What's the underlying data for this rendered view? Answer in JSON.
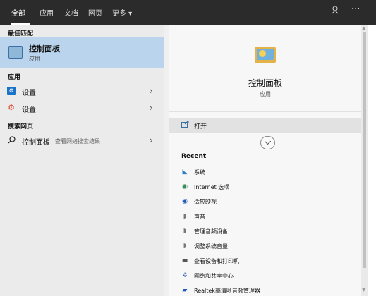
{
  "topbar": {
    "tabs": [
      {
        "label": "全部"
      },
      {
        "label": "应用"
      },
      {
        "label": "文档"
      },
      {
        "label": "网页"
      },
      {
        "label": "更多 ▾"
      }
    ],
    "feedback_icon": "feedback-icon",
    "more_icon": "ellipsis-icon"
  },
  "left": {
    "best_match_header": "最佳匹配",
    "best_match": {
      "title": "控制面板",
      "subtitle": "应用",
      "icon": "control-panel-icon"
    },
    "apps_header": "应用",
    "apps": [
      {
        "label": "设置",
        "icon": "gear-icon"
      },
      {
        "label": "设置",
        "icon": "gear-orange-icon"
      }
    ],
    "web_header": "搜索网页",
    "web_result": {
      "label": "控制面板",
      "hint": "查看网络搜索结果",
      "icon": "search-icon"
    }
  },
  "right": {
    "title": "控制面板",
    "subtitle": "应用",
    "open_label": "打开",
    "recent_header": "Recent",
    "recent": [
      {
        "label": "系统"
      },
      {
        "label": "Internet 选项"
      },
      {
        "label": "适应映视"
      },
      {
        "label": "声音"
      },
      {
        "label": "管理音频设备"
      },
      {
        "label": "调整系统音量"
      },
      {
        "label": "查看设备和打印机"
      },
      {
        "label": "网络和共享中心"
      },
      {
        "label": "Realtek高清晰音频管理器"
      }
    ]
  },
  "colors": {
    "topbar": "#2b2b2b",
    "selection": "#b9d4ec",
    "left_bg": "#ebebeb",
    "right_bg": "#f7f7f7"
  }
}
